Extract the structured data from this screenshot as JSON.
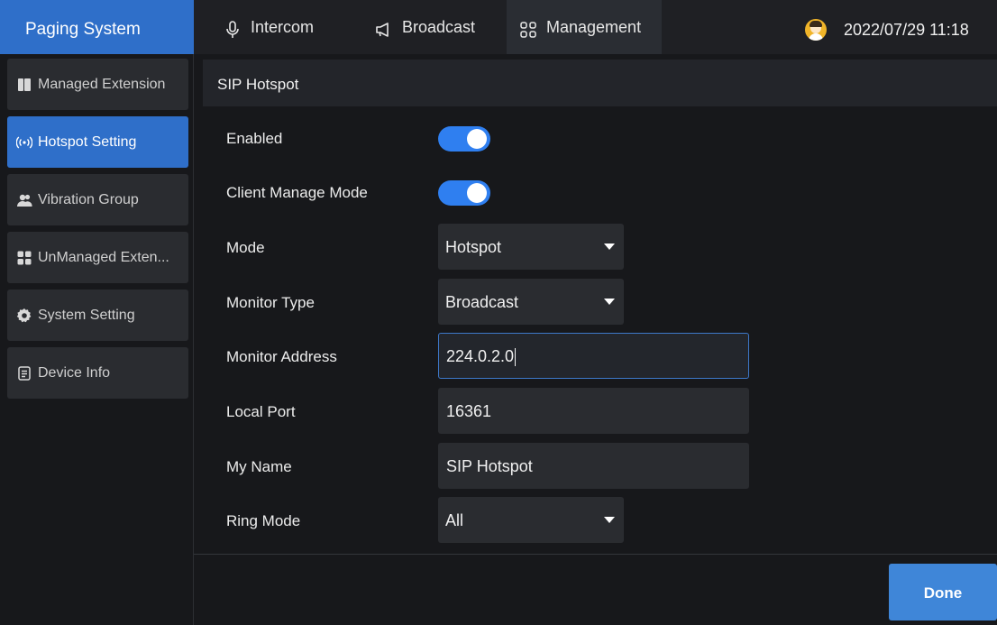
{
  "header": {
    "title": "Paging System",
    "nav": [
      {
        "label": "Intercom",
        "icon": "microphone-icon"
      },
      {
        "label": "Broadcast",
        "icon": "megaphone-icon"
      },
      {
        "label": "Management",
        "icon": "grid-icon"
      }
    ],
    "datetime": "2022/07/29 11:18"
  },
  "sidebar": {
    "items": [
      {
        "label": "Managed Extension",
        "icon": "book-icon"
      },
      {
        "label": "Hotspot Setting",
        "icon": "hotspot-icon"
      },
      {
        "label": "Vibration Group",
        "icon": "group-icon"
      },
      {
        "label": "UnManaged Exten...",
        "icon": "apps-icon"
      },
      {
        "label": "System Setting",
        "icon": "gear-icon"
      },
      {
        "label": "Device Info",
        "icon": "document-icon"
      }
    ]
  },
  "section": {
    "title": "SIP Hotspot"
  },
  "form": {
    "enabled": {
      "label": "Enabled",
      "on": true
    },
    "client_manage_mode": {
      "label": "Client Manage Mode",
      "on": true
    },
    "mode": {
      "label": "Mode",
      "value": "Hotspot"
    },
    "monitor_type": {
      "label": "Monitor Type",
      "value": "Broadcast"
    },
    "monitor_address": {
      "label": "Monitor Address",
      "value": "224.0.2.0"
    },
    "local_port": {
      "label": "Local Port",
      "value": "16361"
    },
    "my_name": {
      "label": "My Name",
      "value": "SIP Hotspot"
    },
    "ring_mode": {
      "label": "Ring Mode",
      "value": "All"
    }
  },
  "actions": {
    "done_label": "Done"
  },
  "colors": {
    "accent": "#2f6fc9",
    "toggle_on": "#2f7ff0",
    "background": "#17181b"
  }
}
